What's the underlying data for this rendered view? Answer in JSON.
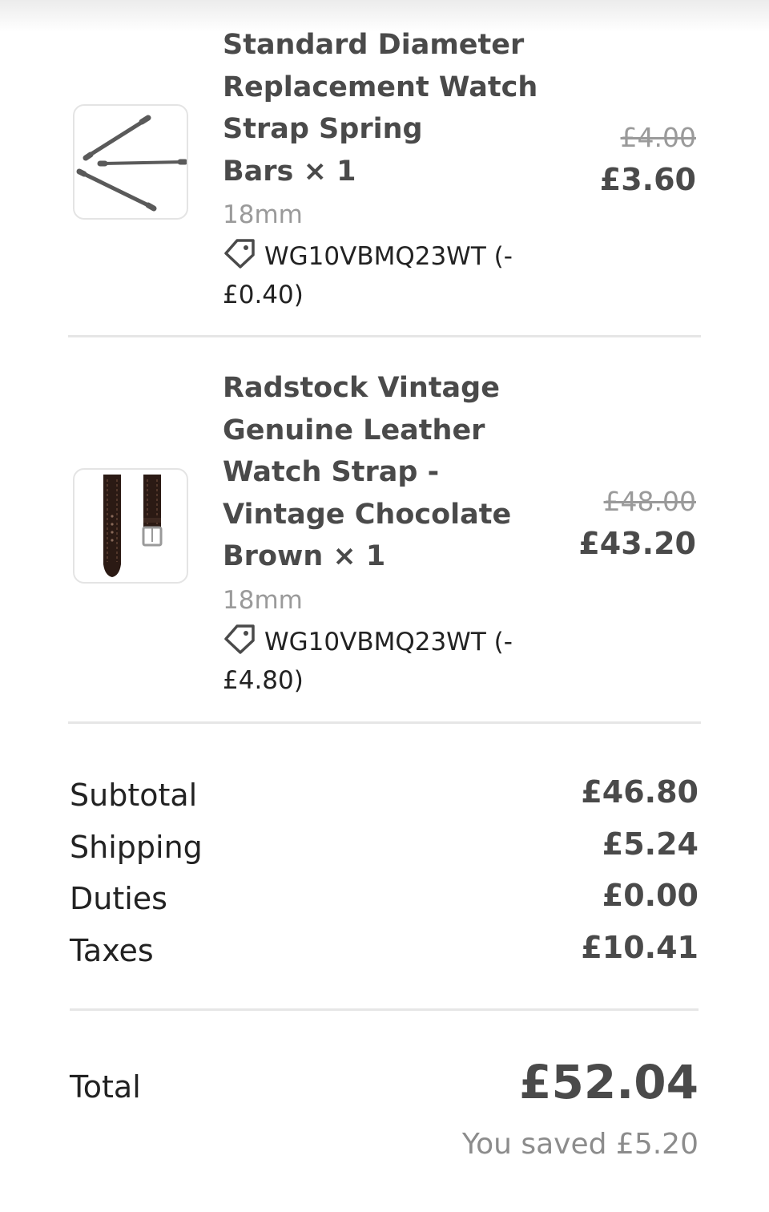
{
  "items": [
    {
      "title": "Standard Diameter\nReplacement Watch\nStrap Spring\nBars × 1",
      "variant": "18mm",
      "discount": "WG10VBMQ23WT (-\n£0.40)",
      "original_price": "£4.00",
      "price": "£3.60",
      "thumbnail": "spring-bars-image"
    },
    {
      "title": "Radstock Vintage\nGenuine Leather\nWatch Strap -\nVintage Chocolate\nBrown × 1",
      "variant": "18mm",
      "discount": "WG10VBMQ23WT (-\n£4.80)",
      "original_price": "£48.00",
      "price": "£43.20",
      "thumbnail": "leather-strap-image"
    }
  ],
  "summary": {
    "subtotal_label": "Subtotal",
    "subtotal_value": "£46.80",
    "shipping_label": "Shipping",
    "shipping_value": "£5.24",
    "duties_label": "Duties",
    "duties_value": "£0.00",
    "taxes_label": "Taxes",
    "taxes_value": "£10.41"
  },
  "total": {
    "label": "Total",
    "value": "£52.04",
    "saved": "You saved £5.20"
  },
  "icons": {
    "discount": "tag-icon"
  },
  "colors": {
    "text_dark": "#222222",
    "text_bold": "#4a4a4a",
    "text_muted": "#9a9a9a",
    "divider": "#e6e6e6"
  }
}
